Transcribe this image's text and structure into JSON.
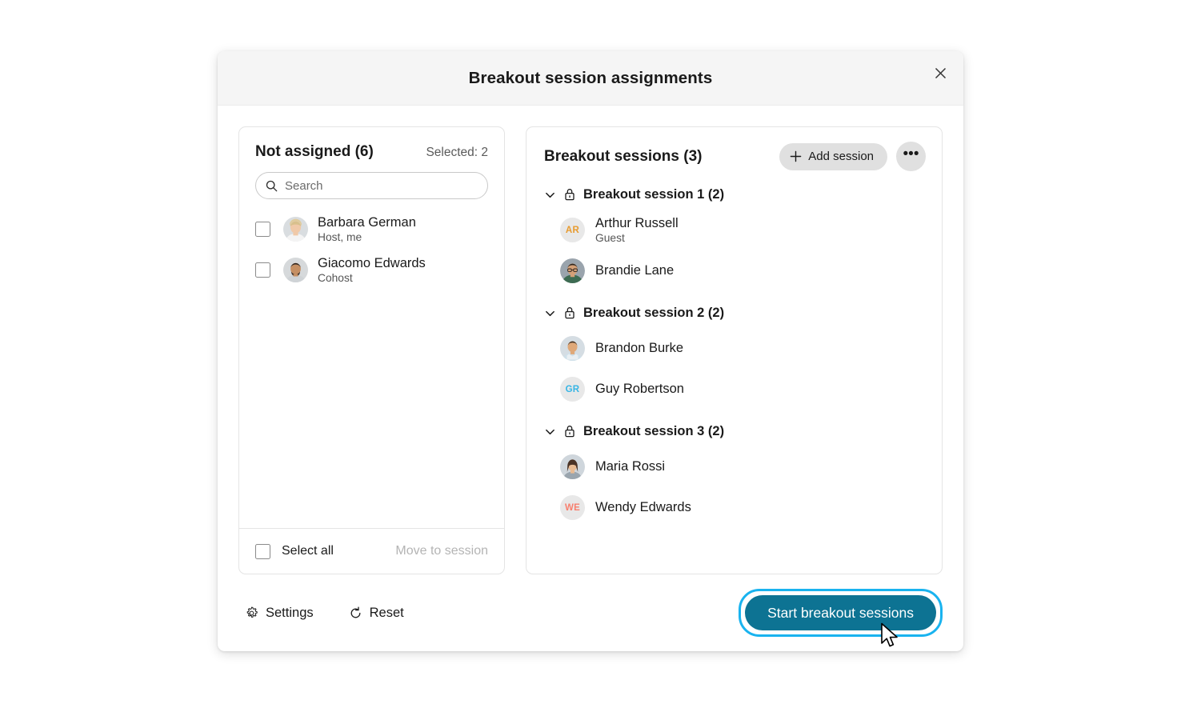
{
  "dialog": {
    "title": "Breakout session assignments",
    "close_label": "Close"
  },
  "not_assigned": {
    "title": "Not assigned (6)",
    "selected_label": "Selected: 2",
    "search_placeholder": "Search",
    "search_value": "",
    "people": [
      {
        "name": "Barbara German",
        "role": "Host, me",
        "avatar_type": "photo",
        "checked": false
      },
      {
        "name": "Giacomo Edwards",
        "role": "Cohost",
        "avatar_type": "photo",
        "checked": false
      }
    ],
    "select_all_label": "Select all",
    "move_to_session_label": "Move to session"
  },
  "breakout": {
    "title": "Breakout sessions (3)",
    "add_session_label": "Add session",
    "more_label": "•••",
    "sessions": [
      {
        "name": "Breakout session 1 (2)",
        "locked": true,
        "expanded": true,
        "members": [
          {
            "name": "Arthur Russell",
            "sub": "Guest",
            "avatar_type": "initials",
            "initials": "AR",
            "initials_color": "#e79b2f"
          },
          {
            "name": "Brandie Lane",
            "sub": "",
            "avatar_type": "photo",
            "photo": "brandie"
          }
        ]
      },
      {
        "name": "Breakout session 2 (2)",
        "locked": true,
        "expanded": true,
        "members": [
          {
            "name": "Brandon Burke",
            "sub": "",
            "avatar_type": "photo",
            "photo": "brandon"
          },
          {
            "name": "Guy Robertson",
            "sub": "",
            "avatar_type": "initials",
            "initials": "GR",
            "initials_color": "#36b5e5"
          }
        ]
      },
      {
        "name": "Breakout session 3 (2)",
        "locked": true,
        "expanded": true,
        "members": [
          {
            "name": "Maria Rossi",
            "sub": "",
            "avatar_type": "photo",
            "photo": "maria"
          },
          {
            "name": "Wendy Edwards",
            "sub": "",
            "avatar_type": "initials",
            "initials": "WE",
            "initials_color": "#f87f6e"
          }
        ]
      }
    ]
  },
  "footer": {
    "settings_label": "Settings",
    "reset_label": "Reset",
    "start_label": "Start breakout sessions"
  },
  "colors": {
    "accent_button": "#0d7393",
    "focus_ring": "#19b3ef",
    "header_bg": "#f5f5f5",
    "panel_border": "#e4e4e4",
    "avatar_bg": "#e8e8e8"
  }
}
